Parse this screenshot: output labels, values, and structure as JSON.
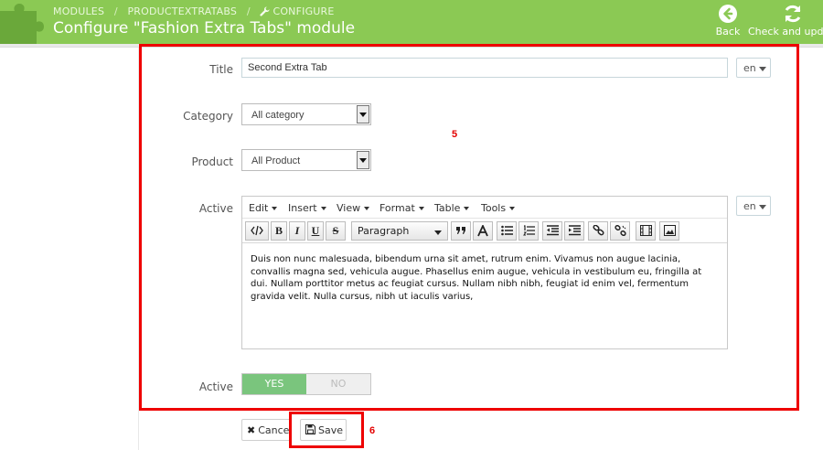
{
  "header": {
    "breadcrumb": [
      "MODULES",
      "PRODUCTEXTRATABS",
      "CONFIGURE"
    ],
    "breadcrumb_sep": "/",
    "title": "Configure \"Fashion Extra Tabs\" module",
    "back_label": "Back",
    "check_label": "Check and update",
    "accent_color": "#8bc954"
  },
  "form": {
    "title_label": "Title",
    "title_value": "Second Extra Tab",
    "lang": "en",
    "category_label": "Category",
    "category_value": "All category",
    "product_label": "Product",
    "product_value": "All Product",
    "active_label": "Active",
    "editor": {
      "menus": [
        "Edit",
        "Insert",
        "View",
        "Format",
        "Table",
        "Tools"
      ],
      "block_format": "Paragraph",
      "content": "Duis non nunc malesuada, bibendum urna sit amet, rutrum enim. Vivamus non augue lacinia, convallis magna sed, vehicula augue. Phasellus enim augue, vehicula in vestibulum eu, fringilla at dui. Nullam porttitor metus ac feugiat cursus. Nullam nibh nibh, feugiat id enim vel, fermentum gravida velit. Nulla cursus, nibh ut iaculis varius,"
    },
    "toggle_label": "Active",
    "toggle_yes": "YES",
    "toggle_no": "NO",
    "toggle_selected": "YES"
  },
  "actions": {
    "cancel_label": "Cancel",
    "save_label": "Save"
  },
  "annotations": {
    "box_main": "5",
    "box_save": "6",
    "color": "#ee0000"
  }
}
